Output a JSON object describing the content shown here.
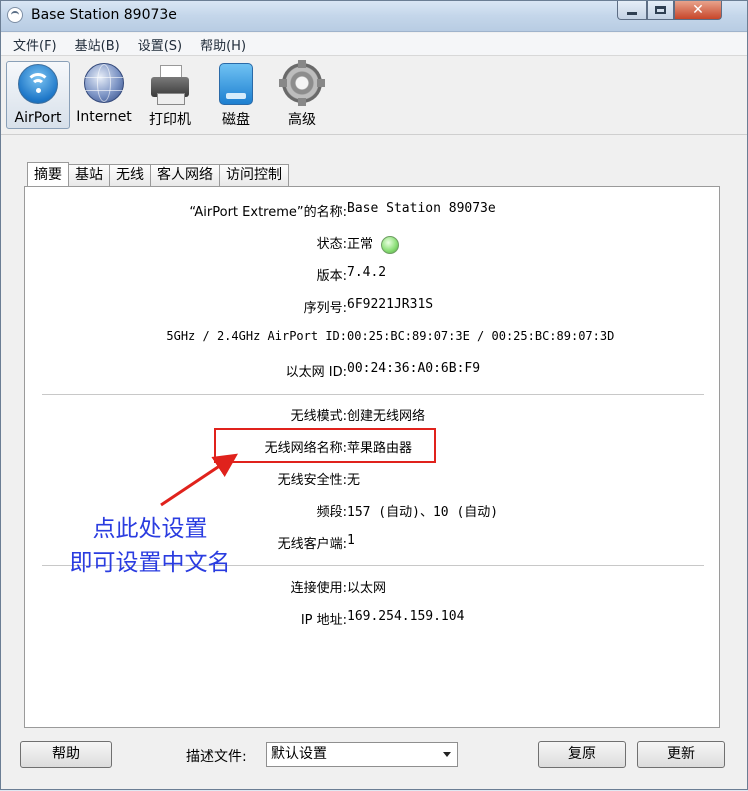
{
  "window": {
    "title": "Base Station 89073e",
    "close_glyph": "✕"
  },
  "menu": [
    "文件(F)",
    "基站(B)",
    "设置(S)",
    "帮助(H)"
  ],
  "toolbar": [
    {
      "label": "AirPort",
      "icon": "airport-wifi-icon",
      "active": true
    },
    {
      "label": "Internet",
      "icon": "globe-icon"
    },
    {
      "label": "打印机",
      "icon": "printer-icon"
    },
    {
      "label": "磁盘",
      "icon": "disk-icon"
    },
    {
      "label": "高级",
      "icon": "gear-icon"
    }
  ],
  "tabs": [
    "摘要",
    "基站",
    "无线",
    "客人网络",
    "访问控制"
  ],
  "summary": {
    "name_label": "“AirPort Extreme”的名称:",
    "name_value": "Base Station 89073e",
    "status_label": "状态:",
    "status_value": "正常",
    "status_color": "#8ee07a",
    "version_label": "版本:",
    "version_value": "7.4.2",
    "serial_label": "序列号:",
    "serial_value": "6F9221JR31S",
    "airport_id_label": "5GHz / 2.4GHz AirPort ID:",
    "airport_id_value": "00:25:BC:89:07:3E / 00:25:BC:89:07:3D",
    "ethernet_id_label": "以太网 ID:",
    "ethernet_id_value": "00:24:36:A0:6B:F9",
    "wireless_mode_label": "无线模式:",
    "wireless_mode_value": "创建无线网络",
    "network_name_label": "无线网络名称:",
    "network_name_value": "苹果路由器",
    "security_label": "无线安全性:",
    "security_value": "无",
    "band_label": "频段:",
    "band_value": "157 (自动)、10 (自动)",
    "clients_label": "无线客户端:",
    "clients_value": "1",
    "connect_label": "连接使用:",
    "connect_value": "以太网",
    "ip_label": "IP 地址:",
    "ip_value": "169.254.159.104"
  },
  "annotation": {
    "line1": "点此处设置",
    "line2": "即可设置中文名",
    "color": "#2a3ce0",
    "box_color": "#e0221c"
  },
  "bottom": {
    "help_label": "帮助",
    "profile_label": "描述文件:",
    "profile_value": "默认设置",
    "revert_label": "复原",
    "update_label": "更新"
  }
}
